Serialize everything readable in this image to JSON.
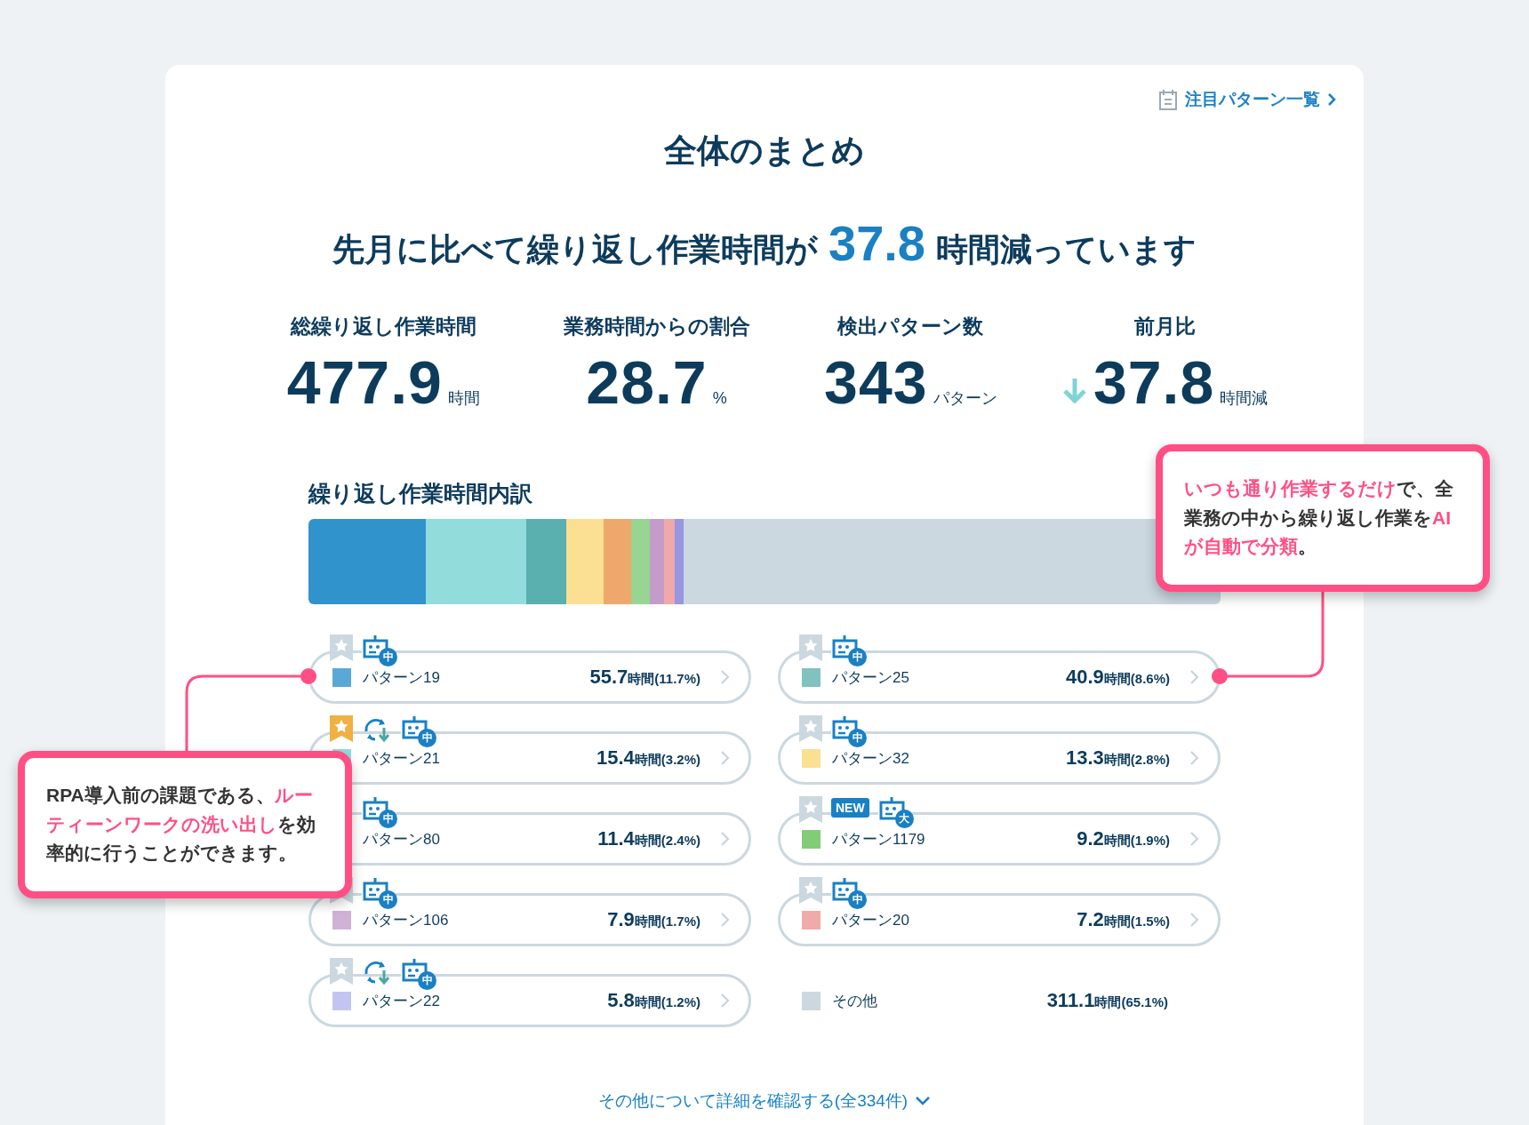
{
  "header_link": {
    "label": "注目パターン一覧"
  },
  "title": "全体のまとめ",
  "headline": {
    "before": "先月に比べて繰り返し作業時間が",
    "number": "37.8",
    "after": "時間減っています"
  },
  "stats": [
    {
      "label": "総繰り返し作業時間",
      "value": "477.9",
      "unit": "時間"
    },
    {
      "label": "業務時間からの割合",
      "value": "28.7",
      "unit": "%"
    },
    {
      "label": "検出パターン数",
      "value": "343",
      "unit": "パターン"
    },
    {
      "label": "前月比",
      "value": "37.8",
      "unit": "時間減",
      "decrease": true
    }
  ],
  "breakdown": {
    "title": "繰り返し作業時間内訳",
    "columns": [
      [
        {
          "kind": "pattern",
          "name": "パターン19",
          "color": "#5aa8d6",
          "hours": "55.7",
          "share": "時間(11.7%)",
          "favorite": false,
          "badges": [
            {
              "kind": "robot",
              "label": "中"
            }
          ]
        },
        {
          "kind": "pattern",
          "name": "パターン21",
          "color": "#93dcdc",
          "hours": "15.4",
          "share": "時間(3.2%)",
          "favorite": true,
          "badges": [
            {
              "kind": "sync"
            },
            {
              "kind": "robot",
              "label": "中"
            }
          ]
        },
        {
          "kind": "pattern",
          "name": "パターン80",
          "hours": "11.4",
          "share": "時間(2.4%)",
          "badges": [
            {
              "kind": "robot",
              "label": "中"
            }
          ]
        },
        {
          "kind": "pattern",
          "name": "パターン106",
          "color": "#cfb2d6",
          "hours": "7.9",
          "share": "時間(1.7%)",
          "favorite": false,
          "badges": [
            {
              "kind": "robot",
              "label": "中"
            }
          ]
        },
        {
          "kind": "pattern",
          "name": "パターン22",
          "color": "#c4c4f2",
          "hours": "5.8",
          "share": "時間(1.2%)",
          "favorite": false,
          "badges": [
            {
              "kind": "sync"
            },
            {
              "kind": "robot",
              "label": "中"
            }
          ]
        }
      ],
      [
        {
          "kind": "pattern",
          "name": "パターン25",
          "color": "#7fc2c0",
          "hours": "40.9",
          "share": "時間(8.6%)",
          "favorite": false,
          "badges": [
            {
              "kind": "robot",
              "label": "中"
            }
          ]
        },
        {
          "kind": "pattern",
          "name": "パターン32",
          "color": "#fbe092",
          "hours": "13.3",
          "share": "時間(2.8%)",
          "favorite": false,
          "badges": [
            {
              "kind": "robot",
              "label": "中"
            }
          ]
        },
        {
          "kind": "pattern",
          "name": "パターン1179",
          "color": "#82cc78",
          "hours": "9.2",
          "share": "時間(1.9%)",
          "favorite": false,
          "badges": [
            {
              "kind": "new",
              "label": "NEW"
            },
            {
              "kind": "robot",
              "label": "大"
            }
          ]
        },
        {
          "kind": "pattern",
          "name": "パターン20",
          "color": "#f0aaaa",
          "hours": "7.2",
          "share": "時間(1.5%)",
          "favorite": false,
          "badges": [
            {
              "kind": "robot",
              "label": "中"
            }
          ]
        },
        {
          "kind": "other",
          "name": "その他",
          "color": "#cbd8e0",
          "hours": "311.1",
          "share": "時間(65.1%)"
        }
      ]
    ]
  },
  "more_link": {
    "label": "その他について詳細を確認する(全334件)"
  },
  "callouts": [
    {
      "kind": "right",
      "segments": [
        {
          "text": "いつも通り作業するだけ",
          "highlight": true
        },
        {
          "text": "で、全業務の中から繰り返し作業を",
          "highlight": false
        },
        {
          "text": "AIが自動で分類",
          "highlight": true
        },
        {
          "text": "。",
          "highlight": false
        }
      ]
    },
    {
      "kind": "left",
      "segments": [
        {
          "text": "RPA導入前の課題である、",
          "highlight": false
        },
        {
          "text": "ルーティーンワークの洗い出し",
          "highlight": true
        },
        {
          "text": "を効率的に行うことができます。",
          "highlight": false
        }
      ]
    }
  ]
}
